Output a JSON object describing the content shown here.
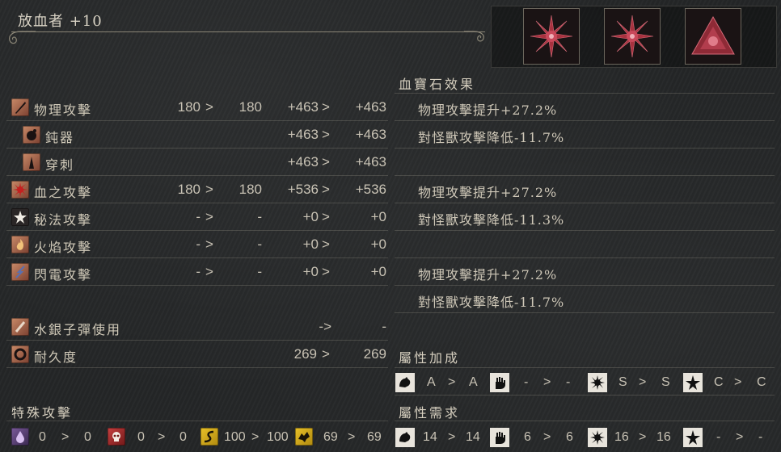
{
  "weapon": {
    "title": "放血者 +10"
  },
  "gems_header": "血寶石效果",
  "stats": [
    {
      "label": "物理攻擊",
      "base_from": "180",
      "base_to": "180",
      "bonus_from": "+463",
      "bonus_to": "+463",
      "icon": "physical-attack-icon"
    },
    {
      "label": "鈍器",
      "base_from": "",
      "base_to": "",
      "bonus_from": "+463",
      "bonus_to": "+463",
      "icon": "blunt-icon"
    },
    {
      "label": "穿刺",
      "base_from": "",
      "base_to": "",
      "bonus_from": "+463",
      "bonus_to": "+463",
      "icon": "thrust-icon"
    },
    {
      "label": "血之攻擊",
      "base_from": "180",
      "base_to": "180",
      "bonus_from": "+536",
      "bonus_to": "+536",
      "icon": "blood-attack-icon"
    },
    {
      "label": "秘法攻擊",
      "base_from": "-",
      "base_to": "-",
      "bonus_from": "+0",
      "bonus_to": "+0",
      "icon": "arcane-attack-icon"
    },
    {
      "label": "火焰攻擊",
      "base_from": "-",
      "base_to": "-",
      "bonus_from": "+0",
      "bonus_to": "+0",
      "icon": "fire-attack-icon"
    },
    {
      "label": "閃電攻擊",
      "base_from": "-",
      "base_to": "-",
      "bonus_from": "+0",
      "bonus_to": "+0",
      "icon": "bolt-attack-icon"
    }
  ],
  "quicksilver": {
    "label": "水銀子彈使用",
    "from": "-",
    "to": "-"
  },
  "durability": {
    "label": "耐久度",
    "from": "269",
    "to": "269"
  },
  "effects": [
    "物理攻擊提升+27.2%",
    "對怪獸攻擊降低-11.7%",
    "物理攻擊提升+27.2%",
    "對怪獸攻擊降低-11.3%",
    "物理攻擊提升+27.2%",
    "對怪獸攻擊降低-11.7%"
  ],
  "special": {
    "header": "特殊攻擊",
    "items": [
      {
        "icon": "rapid-poison-icon",
        "from": "0",
        "to": "0"
      },
      {
        "icon": "skull-icon",
        "from": "0",
        "to": "0"
      },
      {
        "icon": "serpent-icon",
        "from": "100",
        "to": "100"
      },
      {
        "icon": "beast-icon",
        "from": "69",
        "to": "69"
      }
    ]
  },
  "scaling": {
    "header": "屬性加成",
    "items": [
      {
        "icon": "strength-icon",
        "from": "A",
        "to": "A"
      },
      {
        "icon": "skill-hand-icon",
        "from": "-",
        "to": "-"
      },
      {
        "icon": "bloodtinge-icon",
        "from": "S",
        "to": "S"
      },
      {
        "icon": "arcane-star-icon",
        "from": "C",
        "to": "C"
      }
    ]
  },
  "requirements": {
    "header": "屬性需求",
    "items": [
      {
        "icon": "strength-icon",
        "from": "14",
        "to": "14"
      },
      {
        "icon": "skill-hand-icon",
        "from": "6",
        "to": "6"
      },
      {
        "icon": "bloodtinge-icon",
        "from": "16",
        "to": "16"
      },
      {
        "icon": "arcane-star-icon",
        "from": "-",
        "to": "-"
      }
    ]
  },
  "arrow": ">",
  "arrow_short": "->"
}
